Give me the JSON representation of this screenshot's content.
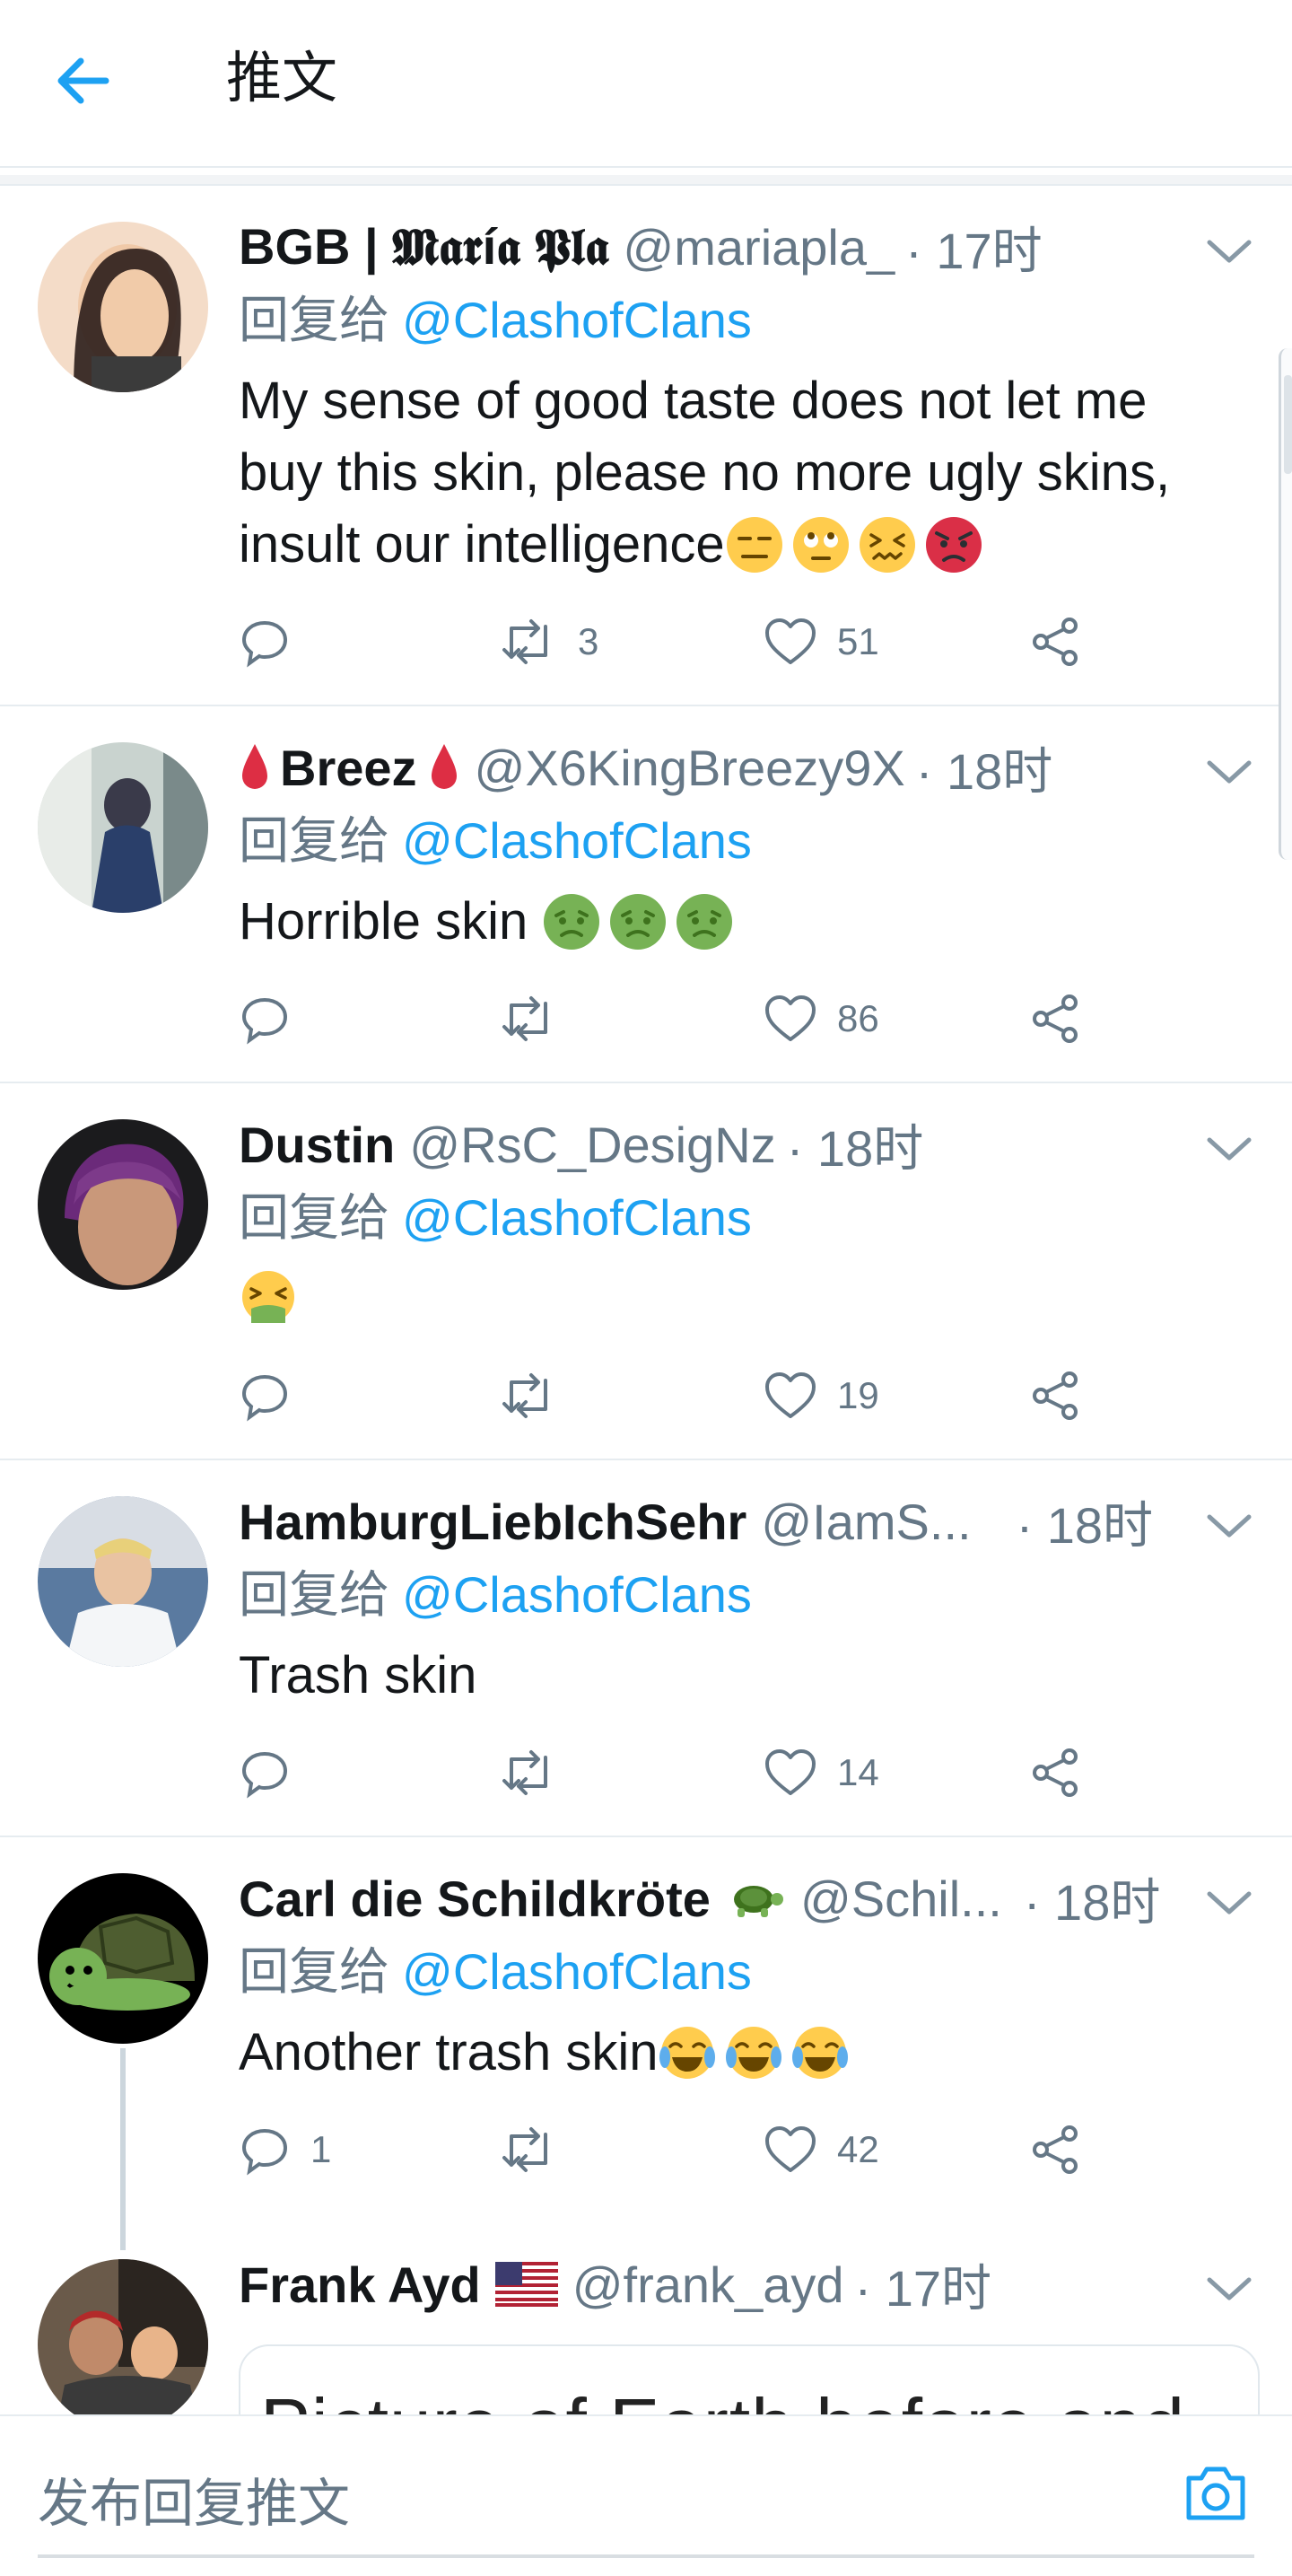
{
  "header": {
    "title": "推文",
    "back_icon": "back-arrow-icon"
  },
  "colors": {
    "accent": "#1da1f2",
    "muted": "#657786",
    "text": "#14171a",
    "divider": "#e6ecf0"
  },
  "tweets": [
    {
      "name": "BGB | 𝕸𝖆𝖗í𝖆 𝕻𝖑𝖆",
      "handle": "@mariapla_",
      "time": "· 17时",
      "reply_prefix": "回复给",
      "reply_to": "@ClashofClans",
      "text": "My sense of good taste does not let me buy this skin, please no more ugly skins, insult our intelligence",
      "emojis": [
        "expressionless-face",
        "face-with-rolling-eyes",
        "confounded-face",
        "pouting-face"
      ],
      "replies": "",
      "retweets": "3",
      "likes": "51"
    },
    {
      "name": "Breez",
      "handle": "@X6KingBreezy9X",
      "time": "· 18时",
      "reply_prefix": "回复给",
      "reply_to": "@ClashofClans",
      "text": "Horrible skin ",
      "emojis": [
        "nauseated-face",
        "nauseated-face",
        "nauseated-face"
      ],
      "replies": "",
      "retweets": "",
      "likes": "86"
    },
    {
      "name": "Dustin",
      "handle": "@RsC_DesigNz",
      "time": "· 18时",
      "reply_prefix": "回复给",
      "reply_to": "@ClashofClans",
      "text": "",
      "emojis": [
        "vomiting-face"
      ],
      "replies": "",
      "retweets": "",
      "likes": "19"
    },
    {
      "name": "HamburgLiebIchSehr",
      "handle": "@IamS...",
      "time": "· 18时",
      "reply_prefix": "回复给",
      "reply_to": "@ClashofClans",
      "text": "Trash skin",
      "emojis": [],
      "replies": "",
      "retweets": "",
      "likes": "14"
    },
    {
      "name": "Carl die Schildkröte",
      "handle": "@Schil...",
      "time": "· 18时",
      "reply_prefix": "回复给",
      "reply_to": "@ClashofClans",
      "text": "Another trash skin",
      "emojis": [
        "face-with-tears-of-joy",
        "face-with-tears-of-joy",
        "face-with-tears-of-joy"
      ],
      "replies": "1",
      "retweets": "",
      "likes": "42"
    },
    {
      "name": "Frank Ayd",
      "handle": "@frank_ayd",
      "time": "· 17时",
      "media_text": "Picture of Earth before and"
    }
  ],
  "composer": {
    "placeholder": "发布回复推文",
    "camera_icon": "camera-icon"
  }
}
